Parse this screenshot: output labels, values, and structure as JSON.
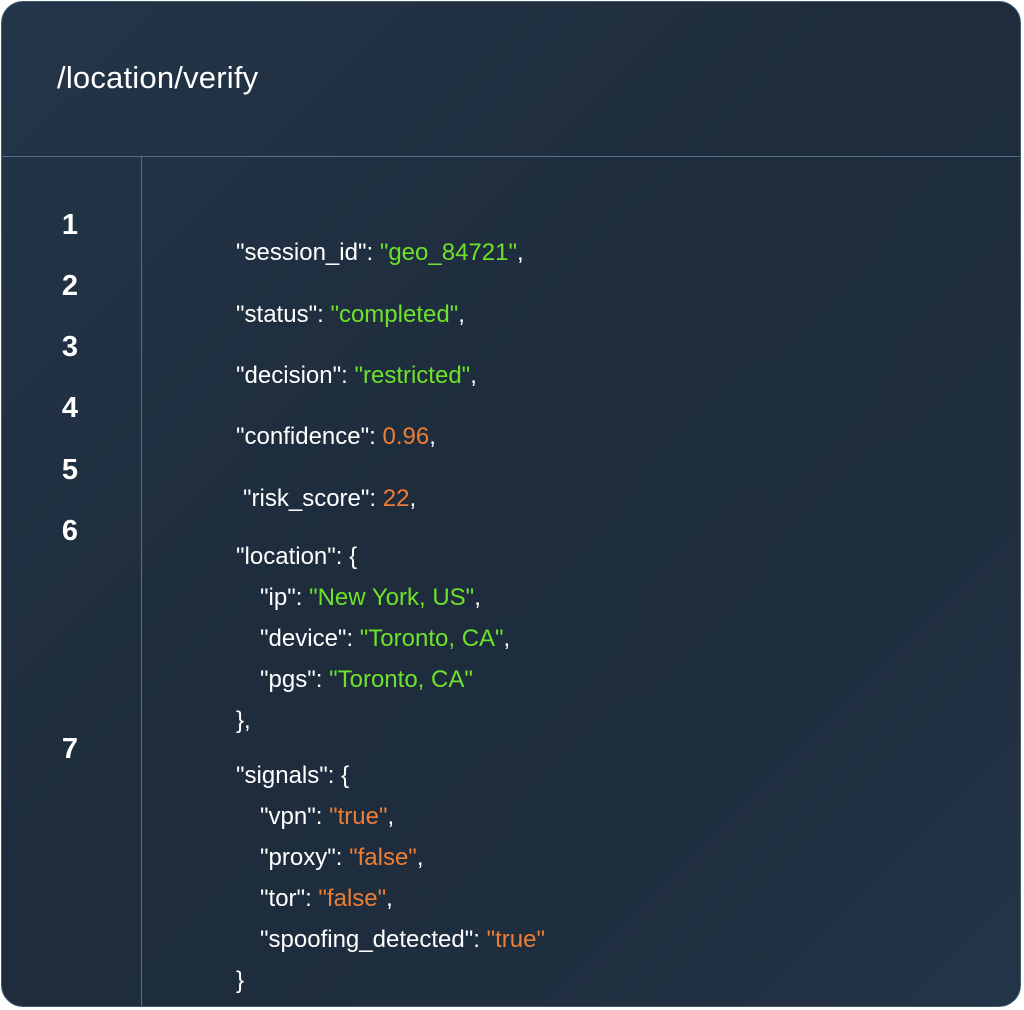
{
  "endpoint": "/location/verify",
  "colors": {
    "background": "#1f2d3d",
    "string": "#6ee22a",
    "number_or_bool": "#ee7d34",
    "key": "#ffffff",
    "divider": "#4f6f8a"
  },
  "line_numbers": [
    "1",
    "2",
    "3",
    "4",
    "5",
    "6",
    "7"
  ],
  "code": {
    "session_id": {
      "key": "\"session_id\"",
      "value": "\"geo_84721\"",
      "trail": ","
    },
    "status": {
      "key": "\"status\"",
      "value": "\"completed\"",
      "trail": ","
    },
    "decision": {
      "key": "\"decision\"",
      "value": "\"restricted\"",
      "trail": ","
    },
    "confidence": {
      "key": "\"confidence\"",
      "value": "0.96",
      "trail": ","
    },
    "risk_score": {
      "key": "\"risk_score\"",
      "value": "22",
      "trail": ","
    },
    "location": {
      "key": "\"location\"",
      "open": "{",
      "ip": {
        "key": "\"ip\"",
        "value": "\"New York, US\"",
        "trail": ","
      },
      "device": {
        "key": "\"device\"",
        "value": "\"Toronto, CA\"",
        "trail": ","
      },
      "pgs": {
        "key": "\"pgs\"",
        "value": "\"Toronto, CA\"",
        "trail": ""
      },
      "close": "},"
    },
    "signals": {
      "key": "\"signals\"",
      "open": "{",
      "vpn": {
        "key": "\"vpn\"",
        "value": "\"true\"",
        "trail": ","
      },
      "proxy": {
        "key": "\"proxy\"",
        "value": "\"false\"",
        "trail": ","
      },
      "tor": {
        "key": "\"tor\"",
        "value": "\"false\"",
        "trail": ","
      },
      "spoofing_detected": {
        "key": "\"spoofing_detected\"",
        "value": "\"true\"",
        "trail": ""
      },
      "close": "}"
    }
  }
}
